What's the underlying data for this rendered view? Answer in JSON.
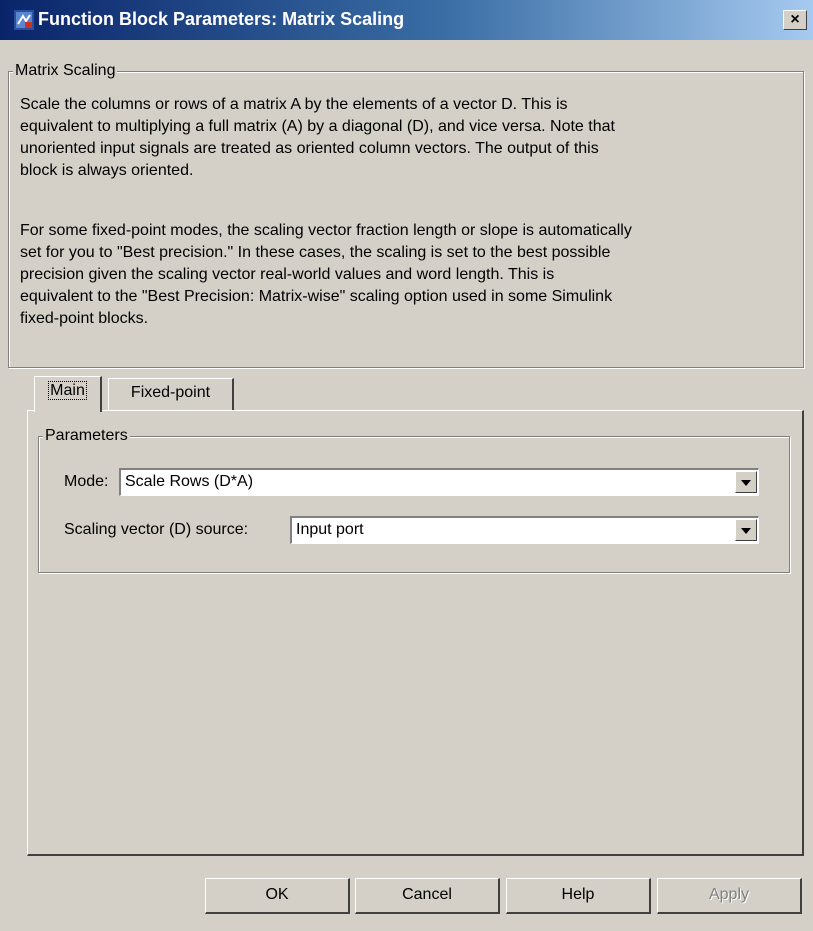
{
  "window": {
    "title": "Function Block Parameters: Matrix Scaling",
    "close_label": "×"
  },
  "description_group": {
    "legend": "Matrix Scaling",
    "para1": [
      "Scale the columns or rows of a matrix A by the elements of a vector D.  This is",
      "equivalent to multiplying a full matrix (A) by a diagonal (D), and vice versa. Note that",
      "unoriented input signals are treated as oriented column vectors. The output of this",
      "block is always oriented."
    ],
    "para2": [
      "For some fixed-point modes, the scaling vector fraction length or slope is automatically",
      "set for you to \"Best precision.\" In these cases, the scaling is set to the best possible",
      "precision given the scaling vector real-world values and word length. This is",
      "equivalent to the \"Best Precision: Matrix-wise\" scaling option used in some Simulink",
      "fixed-point blocks."
    ]
  },
  "tabs": [
    {
      "label": "Main",
      "active": true
    },
    {
      "label": "Fixed-point",
      "active": false
    }
  ],
  "parameters": {
    "legend": "Parameters",
    "mode_label": "Mode:",
    "mode_value": "Scale Rows (D*A)",
    "source_label": "Scaling vector (D) source:",
    "source_value": "Input port"
  },
  "buttons": {
    "ok": "OK",
    "cancel": "Cancel",
    "help": "Help",
    "apply": "Apply"
  },
  "icons": {
    "title_icon": "simulink-block-icon",
    "close_icon": "close-icon",
    "dropdown_icon": "chevron-down-icon"
  }
}
